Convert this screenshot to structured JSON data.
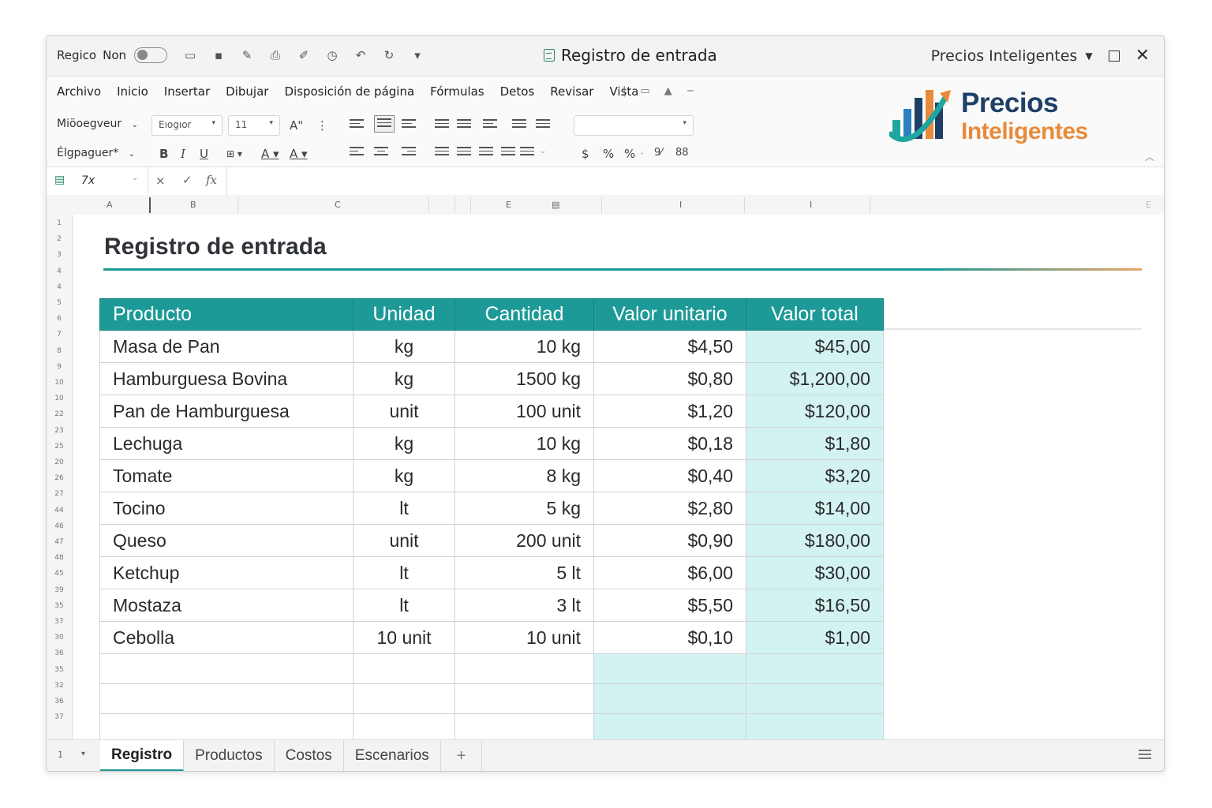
{
  "titlebar": {
    "left_label_1": "Regico",
    "left_label_2": "Non",
    "title": "Registro de entrada",
    "account": "Precios Inteligentes"
  },
  "menu": [
    "Archivo",
    "Inicio",
    "Insertar",
    "Dibujar",
    "Disposición de página",
    "Fórmulas",
    "Detos",
    "Revisar",
    "Vista"
  ],
  "ribbon": {
    "style_dropdown_1": "Miöoegveur",
    "style_dropdown_2": "Élgpaguer*",
    "font_name": "Eıogıor",
    "font_size": "11",
    "font_grow": "A\"",
    "bold": "B",
    "italic": "I",
    "underline": "U",
    "number_format": "",
    "currency": "$",
    "percent_1": "%",
    "percent_2": "%",
    "dec_1": "9⁄",
    "dec_2": "88"
  },
  "logo": {
    "line1": "Precios",
    "line2": "Inteligentes"
  },
  "formula_bar": {
    "name_box": "7x",
    "cancel": "×",
    "confirm": "✓",
    "fx": "fx"
  },
  "columns": [
    "A",
    "B",
    "C",
    "E",
    "I",
    "I",
    "E"
  ],
  "row_numbers": [
    "1",
    "2",
    "3",
    "4",
    "4",
    "5",
    "6",
    "7",
    "8",
    "9",
    "10",
    "10",
    "22",
    "23",
    "25",
    "20",
    "26",
    "27",
    "44",
    "46",
    "47",
    "48",
    "45",
    "39",
    "35",
    "37",
    "30",
    "36",
    "35",
    "32",
    "36",
    "37"
  ],
  "sheet": {
    "title": "Registro de entrada",
    "headers": [
      "Producto",
      "Unidad",
      "Cantidad",
      "Valor unitario",
      "Valor total"
    ],
    "rows": [
      [
        "Masa de Pan",
        "kg",
        "10 kg",
        "$4,50",
        "$45,00"
      ],
      [
        "Hamburguesa Bovina",
        "kg",
        "1500 kg",
        "$0,80",
        "$1,200,00"
      ],
      [
        "Pan de Hamburguesa",
        "unit",
        "100 unit",
        "$1,20",
        "$120,00"
      ],
      [
        "Lechuga",
        "kg",
        "10 kg",
        "$0,18",
        "$1,80"
      ],
      [
        "Tomate",
        "kg",
        "8 kg",
        "$0,40",
        "$3,20"
      ],
      [
        "Tocino",
        "lt",
        "5 kg",
        "$2,80",
        "$14,00"
      ],
      [
        "Queso",
        "unit",
        "200 unit",
        "$0,90",
        "$180,00"
      ],
      [
        "Ketchup",
        "lt",
        "5 lt",
        "$6,00",
        "$30,00"
      ],
      [
        "Mostaza",
        "lt",
        "3 lt",
        "$5,50",
        "$16,50"
      ],
      [
        "Cebolla",
        "10 unit",
        "10 unit",
        "$0,10",
        "$1,00"
      ]
    ]
  },
  "tabs": {
    "prefix": "1",
    "items": [
      "Registro",
      "Productos",
      "Costos",
      "Escenarios"
    ],
    "active": "Registro",
    "add": "+"
  },
  "colors": {
    "accent": "#1d9a98",
    "total_cell": "#d3f3f2",
    "logo_blue": "#1f3f66",
    "logo_orange": "#e98a3b"
  }
}
